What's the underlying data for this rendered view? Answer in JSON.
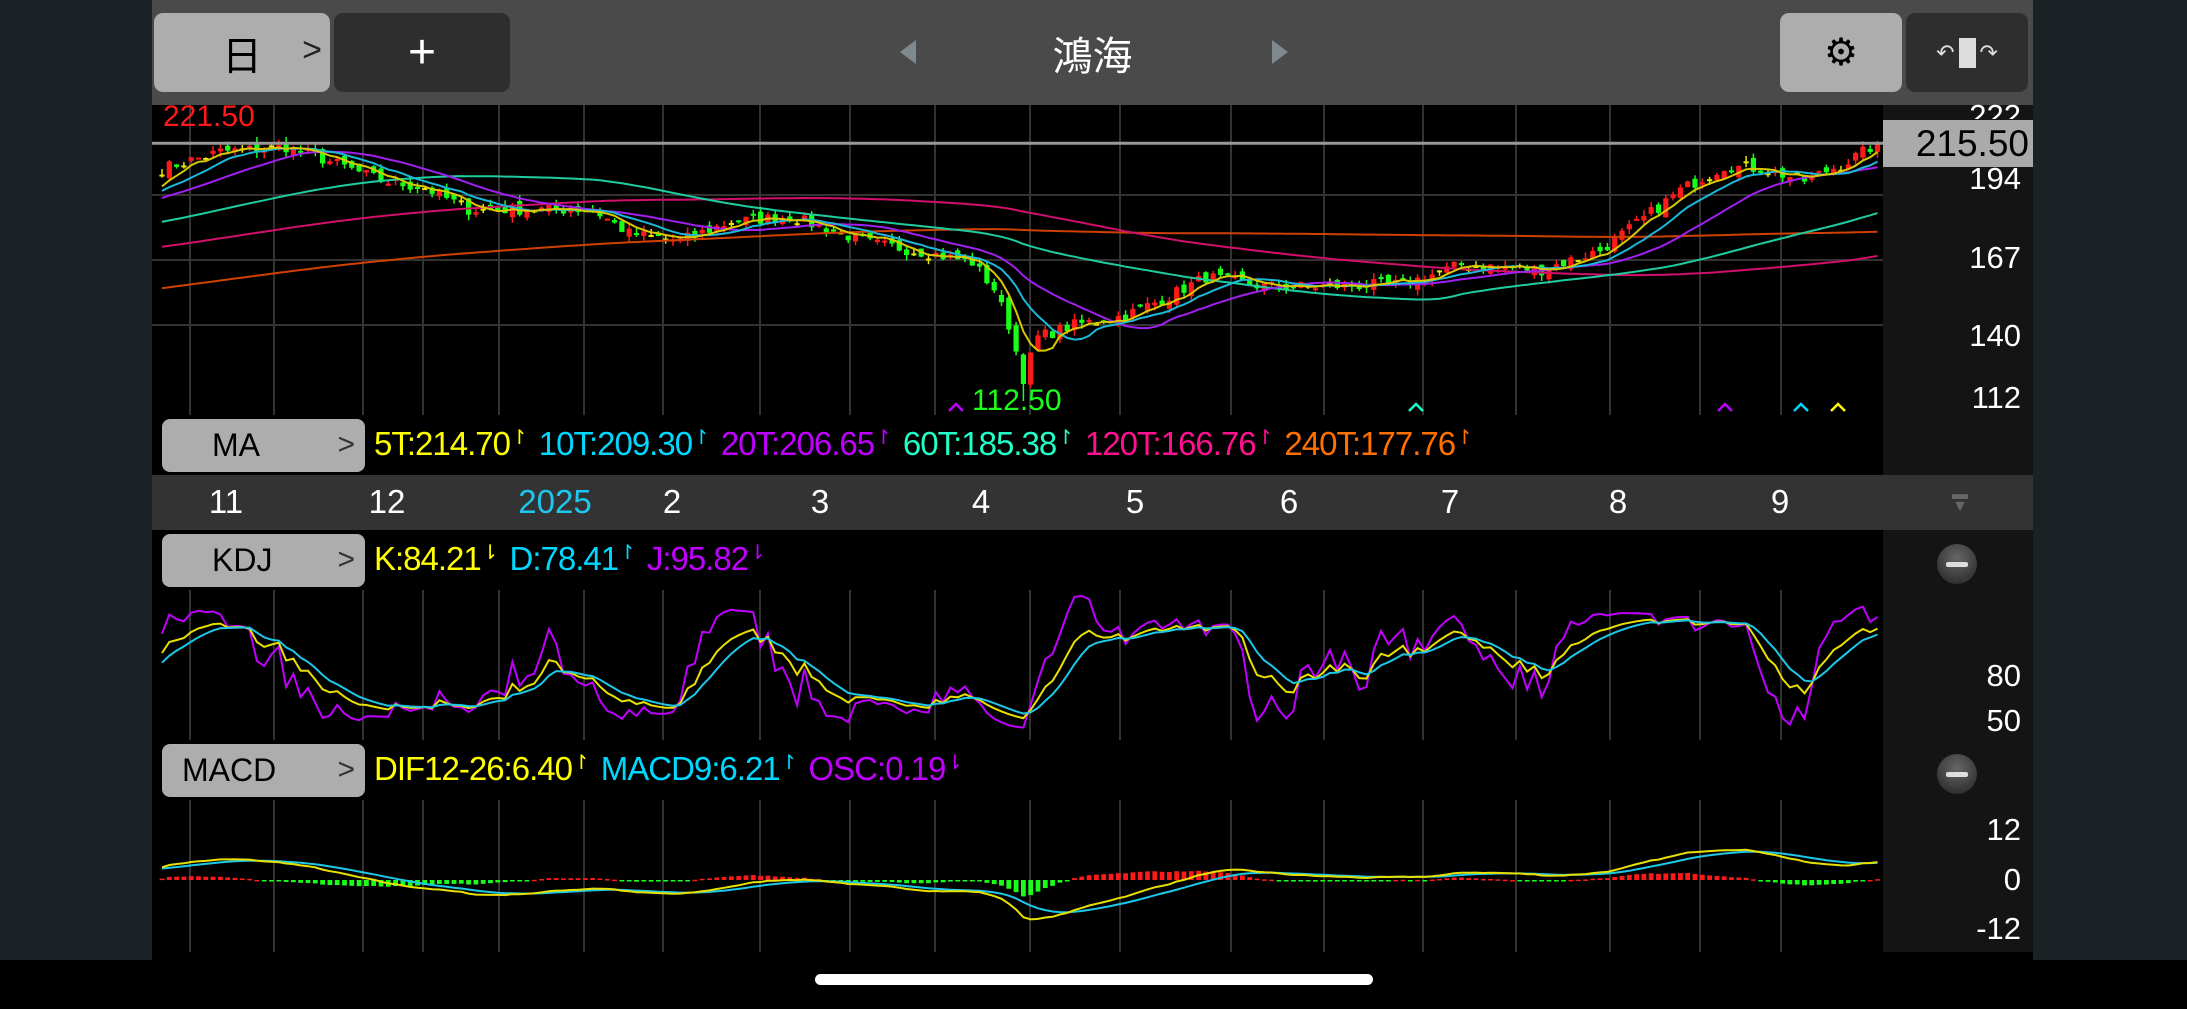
{
  "header": {
    "period_label": "日",
    "add_label": "+",
    "stock_name": "鴻海",
    "icons": [
      "chevron-right-icon",
      "plus-icon",
      "prev-arrow-icon",
      "next-arrow-icon",
      "gear-icon",
      "rotate-screen-icon"
    ]
  },
  "main_chart": {
    "high_label": "221.50",
    "low_label": "112.50",
    "current_price": "215.50",
    "y_ticks": [
      "222",
      "194",
      "167",
      "140",
      "112"
    ],
    "colors": {
      "up": "#ff1a1a",
      "down": "#1aff1a",
      "ma5": "#d8c800",
      "ma10": "#1cb8d8",
      "ma20": "#a020f0",
      "ma60": "#1fcca0",
      "ma120": "#d0106a",
      "ma240": "#d04000"
    },
    "close_waypoints": [
      [
        0,
        205
      ],
      [
        8,
        212
      ],
      [
        17,
        214
      ],
      [
        23,
        208
      ],
      [
        30,
        200
      ],
      [
        36,
        197
      ],
      [
        42,
        188
      ],
      [
        50,
        188
      ],
      [
        59,
        188
      ],
      [
        64,
        178
      ],
      [
        71,
        175
      ],
      [
        78,
        183
      ],
      [
        86,
        185
      ],
      [
        91,
        180
      ],
      [
        97,
        174
      ],
      [
        105,
        170
      ],
      [
        111,
        166
      ],
      [
        114,
        155
      ],
      [
        116,
        140
      ],
      [
        118,
        118
      ],
      [
        120,
        135
      ],
      [
        125,
        140
      ],
      [
        132,
        144
      ],
      [
        138,
        152
      ],
      [
        143,
        160
      ],
      [
        151,
        156
      ],
      [
        159,
        156
      ],
      [
        170,
        157
      ],
      [
        178,
        165
      ],
      [
        189,
        163
      ],
      [
        197,
        171
      ],
      [
        202,
        182
      ],
      [
        208,
        196
      ],
      [
        214,
        206
      ],
      [
        219,
        205
      ],
      [
        225,
        200
      ],
      [
        231,
        208
      ],
      [
        235,
        215.5
      ]
    ]
  },
  "ma": {
    "label": "MA",
    "items": [
      {
        "text": "5T:214.70",
        "color": "#ffff00",
        "dir": "up"
      },
      {
        "text": "10T:209.30",
        "color": "#00d8ff",
        "dir": "up"
      },
      {
        "text": "20T:206.65",
        "color": "#c000ff",
        "dir": "up"
      },
      {
        "text": "60T:185.38",
        "color": "#20ffc8",
        "dir": "up"
      },
      {
        "text": "120T:166.76",
        "color": "#ff1090",
        "dir": "up"
      },
      {
        "text": "240T:177.76",
        "color": "#ff7000",
        "dir": "up"
      }
    ]
  },
  "months": [
    {
      "t": "11"
    },
    {
      "t": "12"
    },
    {
      "t": "2025",
      "c": "#1cc8f0"
    },
    {
      "t": "2"
    },
    {
      "t": "3"
    },
    {
      "t": "4"
    },
    {
      "t": "5"
    },
    {
      "t": "6"
    },
    {
      "t": "7"
    },
    {
      "t": "8"
    },
    {
      "t": "9"
    }
  ],
  "kdj": {
    "label": "KDJ",
    "items": [
      {
        "text": "K:84.21",
        "color": "#ffff00",
        "dir": "down"
      },
      {
        "text": "D:78.41",
        "color": "#00d8ff",
        "dir": "up"
      },
      {
        "text": "J:95.82",
        "color": "#c000ff",
        "dir": "down"
      }
    ],
    "y_ticks": [
      "80",
      "50"
    ]
  },
  "macd": {
    "label": "MACD",
    "items": [
      {
        "text": "DIF12-26:6.40",
        "color": "#ffff00",
        "dir": "up"
      },
      {
        "text": "MACD9:6.21",
        "color": "#00d8ff",
        "dir": "up"
      },
      {
        "text": "OSC:0.19",
        "color": "#c000ff",
        "dir": "down"
      }
    ],
    "y_ticks": [
      "12",
      "0",
      "-12"
    ]
  }
}
